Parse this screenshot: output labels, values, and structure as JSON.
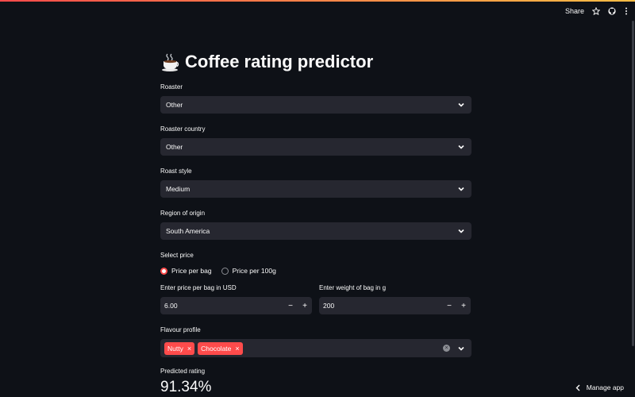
{
  "header": {
    "share_label": "Share",
    "icons": [
      "star-icon",
      "github-icon",
      "more-vertical-icon"
    ]
  },
  "title": {
    "emoji": "coffee-cup-icon",
    "text": "Coffee rating predictor"
  },
  "fields": {
    "roaster": {
      "label": "Roaster",
      "value": "Other"
    },
    "roaster_country": {
      "label": "Roaster country",
      "value": "Other"
    },
    "roast_style": {
      "label": "Roast style",
      "value": "Medium"
    },
    "region": {
      "label": "Region of origin",
      "value": "South America"
    }
  },
  "price_select": {
    "label": "Select price",
    "options": [
      {
        "label": "Price per bag",
        "selected": true
      },
      {
        "label": "Price per 100g",
        "selected": false
      }
    ]
  },
  "price_input": {
    "label": "Enter price per bag in USD",
    "value": "6.00",
    "minus": "−",
    "plus": "+"
  },
  "weight_input": {
    "label": "Enter weight of bag in g",
    "value": "200",
    "minus": "−",
    "plus": "+"
  },
  "flavour": {
    "label": "Flavour profile",
    "tags": [
      "Nutty",
      "Chocolate"
    ],
    "remove_glyph": "×"
  },
  "prediction": {
    "label": "Predicted rating",
    "value": "91.34%"
  },
  "footer": {
    "manage_label": "Manage app"
  },
  "colors": {
    "accent": "#ff4b4b",
    "background": "#0e1117",
    "widget": "#262730"
  }
}
